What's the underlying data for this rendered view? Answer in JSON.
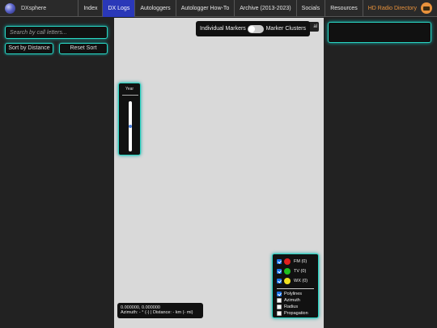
{
  "brand": {
    "title": "DXsphere",
    "icon": "globe-icon"
  },
  "nav": {
    "items": [
      {
        "label": "Index",
        "active": false
      },
      {
        "label": "DX Logs",
        "active": true
      },
      {
        "label": "Autologgers",
        "active": false
      },
      {
        "label": "Autologger How-To",
        "active": false
      },
      {
        "label": "Archive (2013-2023)",
        "active": false
      },
      {
        "label": "Socials",
        "active": false
      },
      {
        "label": "Resources",
        "active": false
      }
    ],
    "hd_radio": {
      "label": "HD Radio Directory",
      "icon": "radio-icon",
      "color": "#e8923c"
    }
  },
  "sidebar": {
    "search": {
      "placeholder": "Search by call letters...",
      "value": ""
    },
    "sort_distance_label": "Sort by Distance",
    "reset_sort_label": "Reset Sort"
  },
  "map": {
    "toggle": {
      "left_label": "Individual Markers",
      "right_label": "Marker Clusters",
      "state": "off"
    },
    "stub_label": "al",
    "year_filter": {
      "label": "Year",
      "level_fraction": 0.5
    },
    "coords": {
      "line1": "0.000000, 0.000000",
      "line2": "Azimuth: - ° (-) | Distance: - km (- mi)"
    },
    "legend": {
      "types": [
        {
          "label": "FM (0)",
          "color": "#e02020",
          "checked": true
        },
        {
          "label": "TV (0)",
          "color": "#20c020",
          "checked": true
        },
        {
          "label": "WX (0)",
          "color": "#f0e020",
          "checked": true
        }
      ],
      "options": [
        {
          "label": "Polylines",
          "checked": true
        },
        {
          "label": "Azimuth",
          "checked": false
        },
        {
          "label": "Radius",
          "checked": false
        },
        {
          "label": "Propagation",
          "checked": false
        }
      ]
    }
  },
  "colors": {
    "accent_border": "#2ad6c2",
    "nav_active": "#2a38b8"
  }
}
